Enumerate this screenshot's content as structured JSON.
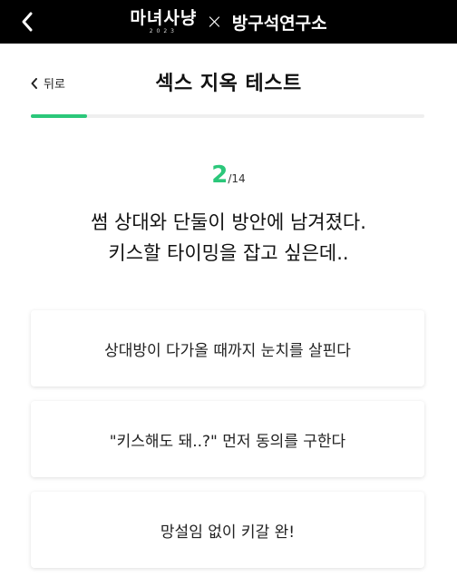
{
  "topbar": {
    "back_icon": "chevron-left-icon",
    "brand_name": "마녀사냥",
    "brand_year": "2023",
    "brand_separator": "×",
    "partner_name": "방구석연구소"
  },
  "header": {
    "back_label": "뒤로",
    "title": "섹스 지옥 테스트"
  },
  "progress": {
    "current": 2,
    "total": 14,
    "fill_fraction": 0.143,
    "color": "#2bc77a"
  },
  "counter": {
    "current": "2",
    "separator": "/",
    "total": "14"
  },
  "question": {
    "line1": "썸 상대와 단둘이 방안에 남겨졌다.",
    "line2": "키스할 타이밍을 잡고 싶은데.."
  },
  "options": [
    {
      "label": "상대방이 다가올 때까지 눈치를 살핀다"
    },
    {
      "label": "\"키스해도 돼..?\" 먼저 동의를 구한다"
    },
    {
      "label": "망설임 없이 키갈 완!"
    }
  ],
  "colors": {
    "accent": "#2bc77a",
    "topbar": "#000000"
  }
}
